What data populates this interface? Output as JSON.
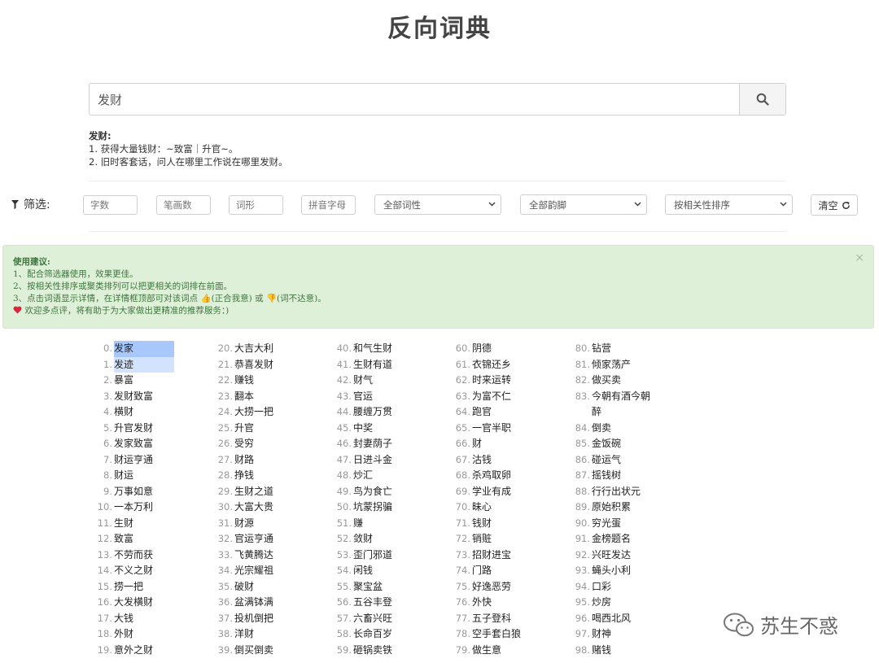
{
  "page_title": "反向词典",
  "search": {
    "value": "发财"
  },
  "definition": {
    "word": "发财:",
    "lines": [
      "1. 获得大量钱财：~致富｜升官~。",
      "2. 旧时客套话，问人在哪里工作说在哪里发财。"
    ]
  },
  "filters": {
    "label": "筛选:",
    "inputs": [
      {
        "placeholder": "字数"
      },
      {
        "placeholder": "笔画数"
      },
      {
        "placeholder": "词形"
      },
      {
        "placeholder": "拼音字母"
      }
    ],
    "selects": [
      {
        "value": "全部词性"
      },
      {
        "value": "全部韵脚"
      },
      {
        "value": "按相关性排序"
      }
    ],
    "clear_label": "清空"
  },
  "tips": {
    "title": "使用建议:",
    "lines": [
      "1、配合筛选器使用，效果更佳。",
      "2、按相关性排序或聚类排列可以把更相关的词排在前面。",
      "3、点击词语显示详情，在详情框顶部可对该词点 👍(正合我意) 或 👎(词不达意)。",
      "欢迎多点评，将有助于为大家做出更精准的推荐服务：)"
    ]
  },
  "results": {
    "col0": [
      {
        "n": "0.",
        "w": "发家"
      },
      {
        "n": "1.",
        "w": "发迹"
      },
      {
        "n": "2.",
        "w": "暴富"
      },
      {
        "n": "3.",
        "w": "发财致富"
      },
      {
        "n": "4.",
        "w": "横财"
      },
      {
        "n": "5.",
        "w": "升官发财"
      },
      {
        "n": "6.",
        "w": "发家致富"
      },
      {
        "n": "7.",
        "w": "财运亨通"
      },
      {
        "n": "8.",
        "w": "财运"
      },
      {
        "n": "9.",
        "w": "万事如意"
      },
      {
        "n": "10.",
        "w": "一本万利"
      },
      {
        "n": "11.",
        "w": "生财"
      },
      {
        "n": "12.",
        "w": "致富"
      },
      {
        "n": "13.",
        "w": "不劳而获"
      },
      {
        "n": "14.",
        "w": "不义之财"
      },
      {
        "n": "15.",
        "w": "捞一把"
      },
      {
        "n": "16.",
        "w": "大发横财"
      },
      {
        "n": "17.",
        "w": "大钱"
      },
      {
        "n": "18.",
        "w": "外财"
      },
      {
        "n": "19.",
        "w": "意外之财"
      }
    ],
    "col1": [
      {
        "n": "20.",
        "w": "大吉大利"
      },
      {
        "n": "21.",
        "w": "恭喜发财"
      },
      {
        "n": "22.",
        "w": "赚钱"
      },
      {
        "n": "23.",
        "w": "翻本"
      },
      {
        "n": "24.",
        "w": "大捞一把"
      },
      {
        "n": "25.",
        "w": "升官"
      },
      {
        "n": "26.",
        "w": "受穷"
      },
      {
        "n": "27.",
        "w": "财路"
      },
      {
        "n": "28.",
        "w": "挣钱"
      },
      {
        "n": "29.",
        "w": "生财之道"
      },
      {
        "n": "30.",
        "w": "大富大贵"
      },
      {
        "n": "31.",
        "w": "财源"
      },
      {
        "n": "32.",
        "w": "官运亨通"
      },
      {
        "n": "33.",
        "w": "飞黄腾达"
      },
      {
        "n": "34.",
        "w": "光宗耀祖"
      },
      {
        "n": "35.",
        "w": "破财"
      },
      {
        "n": "36.",
        "w": "盆满钵满"
      },
      {
        "n": "37.",
        "w": "投机倒把"
      },
      {
        "n": "38.",
        "w": "洋财"
      },
      {
        "n": "39.",
        "w": "倒买倒卖"
      }
    ],
    "col2": [
      {
        "n": "40.",
        "w": "和气生财"
      },
      {
        "n": "41.",
        "w": "生财有道"
      },
      {
        "n": "42.",
        "w": "财气"
      },
      {
        "n": "43.",
        "w": "官运"
      },
      {
        "n": "44.",
        "w": "腰缠万贯"
      },
      {
        "n": "45.",
        "w": "中奖"
      },
      {
        "n": "46.",
        "w": "封妻荫子"
      },
      {
        "n": "47.",
        "w": "日进斗金"
      },
      {
        "n": "48.",
        "w": "炒汇"
      },
      {
        "n": "49.",
        "w": "鸟为食亡"
      },
      {
        "n": "50.",
        "w": "坑蒙拐骗"
      },
      {
        "n": "51.",
        "w": "赚"
      },
      {
        "n": "52.",
        "w": "敛财"
      },
      {
        "n": "53.",
        "w": "歪门邪道"
      },
      {
        "n": "54.",
        "w": "闲钱"
      },
      {
        "n": "55.",
        "w": "聚宝盆"
      },
      {
        "n": "56.",
        "w": "五谷丰登"
      },
      {
        "n": "57.",
        "w": "六畜兴旺"
      },
      {
        "n": "58.",
        "w": "长命百岁"
      },
      {
        "n": "59.",
        "w": "砸锅卖铁"
      }
    ],
    "col3": [
      {
        "n": "60.",
        "w": "阴德"
      },
      {
        "n": "61.",
        "w": "衣锦还乡"
      },
      {
        "n": "62.",
        "w": "时来运转"
      },
      {
        "n": "63.",
        "w": "为富不仁"
      },
      {
        "n": "64.",
        "w": "跑官"
      },
      {
        "n": "65.",
        "w": "一官半职"
      },
      {
        "n": "66.",
        "w": "财"
      },
      {
        "n": "67.",
        "w": "沽钱"
      },
      {
        "n": "68.",
        "w": "杀鸡取卵"
      },
      {
        "n": "69.",
        "w": "学业有成"
      },
      {
        "n": "70.",
        "w": "昧心"
      },
      {
        "n": "71.",
        "w": "钱财"
      },
      {
        "n": "72.",
        "w": "销赃"
      },
      {
        "n": "73.",
        "w": "招财进宝"
      },
      {
        "n": "74.",
        "w": "门路"
      },
      {
        "n": "75.",
        "w": "好逸恶劳"
      },
      {
        "n": "76.",
        "w": "外快"
      },
      {
        "n": "77.",
        "w": "五子登科"
      },
      {
        "n": "78.",
        "w": "空手套白狼"
      },
      {
        "n": "79.",
        "w": "做生意"
      }
    ],
    "col4": [
      {
        "n": "80.",
        "w": "钻营"
      },
      {
        "n": "81.",
        "w": "倾家荡产"
      },
      {
        "n": "82.",
        "w": "做买卖"
      },
      {
        "n": "83.",
        "w": "今朝有酒今朝"
      },
      {
        "n": "",
        "w": "醉"
      },
      {
        "n": "84.",
        "w": "倒卖"
      },
      {
        "n": "85.",
        "w": "金饭碗"
      },
      {
        "n": "86.",
        "w": "碰运气"
      },
      {
        "n": "87.",
        "w": "摇钱树"
      },
      {
        "n": "88.",
        "w": "行行出状元"
      },
      {
        "n": "89.",
        "w": "原始积累"
      },
      {
        "n": "90.",
        "w": "穷光蛋"
      },
      {
        "n": "91.",
        "w": "金榜题名"
      },
      {
        "n": "92.",
        "w": "兴旺发达"
      },
      {
        "n": "93.",
        "w": "蝇头小利"
      },
      {
        "n": "94.",
        "w": "口彩"
      },
      {
        "n": "95.",
        "w": "炒房"
      },
      {
        "n": "96.",
        "w": "喝西北风"
      },
      {
        "n": "97.",
        "w": "财神"
      },
      {
        "n": "98.",
        "w": "赌钱"
      }
    ]
  },
  "watermark": {
    "text": "苏生不惑"
  },
  "colors": {
    "tips_bg": "#dff0d8",
    "tips_text": "#3c763d",
    "highlight": "#a8c7fa",
    "heart": "#e0243a"
  },
  "icons": {
    "search": "search-icon",
    "filter": "filter-icon",
    "refresh": "refresh-icon",
    "heart": "heart-icon",
    "close": "close-icon"
  }
}
